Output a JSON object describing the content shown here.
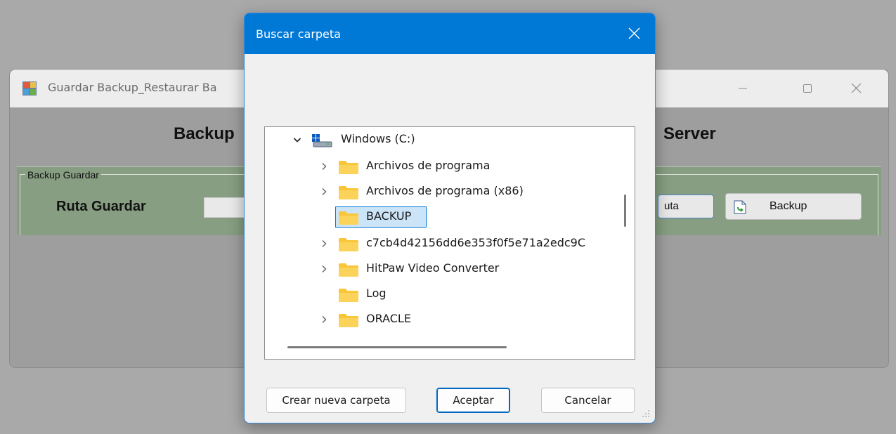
{
  "main_window": {
    "title": "Guardar Backup_Restaurar Ba",
    "heading_left": "Backup",
    "heading_right": "Server",
    "group_label": "Backup Guardar",
    "path_label": "Ruta Guardar",
    "path_value": "",
    "ruta_button_label": "uta",
    "backup_button_label": "Backup"
  },
  "dialog": {
    "title": "Buscar carpeta",
    "tree": {
      "root": {
        "label": "Windows (C:)",
        "expanded": true,
        "icon": "drive-icon"
      },
      "items": [
        {
          "label": "Archivos de programa",
          "has_children": true
        },
        {
          "label": "Archivos de programa (x86)",
          "has_children": true
        },
        {
          "label": "BACKUP",
          "has_children": false,
          "selected": true
        },
        {
          "label": "c7cb4d42156dd6e353f0f5e71a2edc9C",
          "has_children": true
        },
        {
          "label": "HitPaw Video Converter",
          "has_children": true
        },
        {
          "label": "Log",
          "has_children": false
        },
        {
          "label": "ORACLE",
          "has_children": true
        }
      ]
    },
    "buttons": {
      "new_folder": "Crear nueva carpeta",
      "ok": "Aceptar",
      "cancel": "Cancelar"
    }
  },
  "colors": {
    "dialog_titlebar": "#0079d6",
    "selection_fill": "#cce4f7",
    "selection_border": "#0078d7",
    "groupbox": "#879e82",
    "folder": "#f8c638"
  }
}
